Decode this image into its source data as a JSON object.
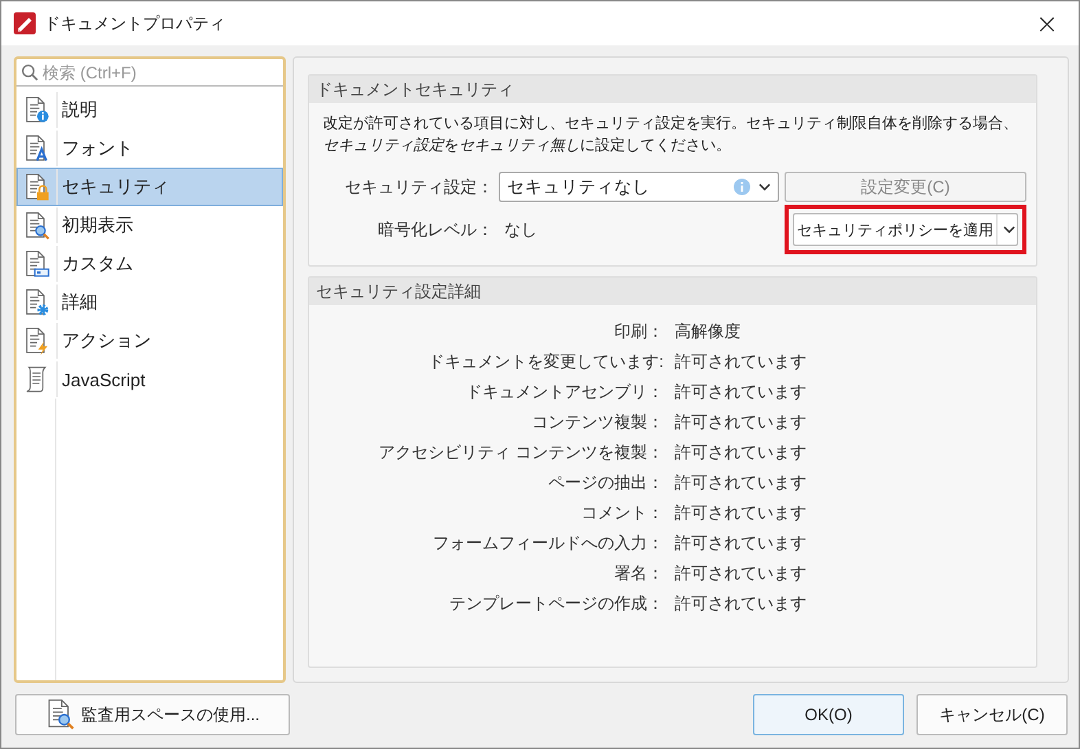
{
  "window": {
    "title": "ドキュメントプロパティ",
    "close": "×"
  },
  "search": {
    "placeholder": "検索 (Ctrl+F)"
  },
  "sidebar": {
    "items": [
      {
        "label": "説明",
        "kind": "info",
        "selected": false
      },
      {
        "label": "フォント",
        "kind": "font",
        "selected": false
      },
      {
        "label": "セキュリティ",
        "kind": "lock",
        "selected": true
      },
      {
        "label": "初期表示",
        "kind": "view",
        "selected": false
      },
      {
        "label": "カスタム",
        "kind": "custom",
        "selected": false
      },
      {
        "label": "詳細",
        "kind": "gear",
        "selected": false
      },
      {
        "label": "アクション",
        "kind": "action",
        "selected": false
      },
      {
        "label": "JavaScript",
        "kind": "script",
        "selected": false
      }
    ]
  },
  "security": {
    "title": "ドキュメントセキュリティ",
    "description": [
      {
        "text": "改定が許可されている項目に対し、セキュリティ設定を実行。セキュリティ制限自体を削除する場合、",
        "italic": false
      },
      {
        "text": "セキュリティ設定",
        "italic": true
      },
      {
        "text": "を",
        "italic": false
      },
      {
        "text": "セキュリティ無し",
        "italic": true
      },
      {
        "text": "に設定してください。",
        "italic": false
      }
    ],
    "setting_label": "セキュリティ設定：",
    "setting_value": "セキュリティなし",
    "change_button": {
      "label": "設定変更(C)",
      "disabled": true
    },
    "level_label": "暗号化レベル：",
    "level_value": "なし",
    "apply_button": {
      "label": "セキュリティポリシーを適用",
      "highlighted": true
    }
  },
  "details": {
    "title": "セキュリティ設定詳細",
    "rows": [
      {
        "label": "印刷：",
        "value": "高解像度"
      },
      {
        "label": "ドキュメントを変更しています:",
        "value": "許可されています"
      },
      {
        "label": "ドキュメントアセンブリ：",
        "value": "許可されています"
      },
      {
        "label": "コンテンツ複製：",
        "value": "許可されています"
      },
      {
        "label": "アクセシビリティ コンテンツを複製：",
        "value": "許可されています"
      },
      {
        "label": "ページの抽出：",
        "value": "許可されています"
      },
      {
        "label": "コメント：",
        "value": "許可されています"
      },
      {
        "label": "フォームフィールドへの入力：",
        "value": "許可されています"
      },
      {
        "label": "署名：",
        "value": "許可されています"
      },
      {
        "label": "テンプレートページの作成：",
        "value": "許可されています"
      }
    ]
  },
  "footer": {
    "audit_button": "監査用スペースの使用...",
    "ok_button": "OK(O)",
    "cancel_button": "キャンセル(C)"
  }
}
